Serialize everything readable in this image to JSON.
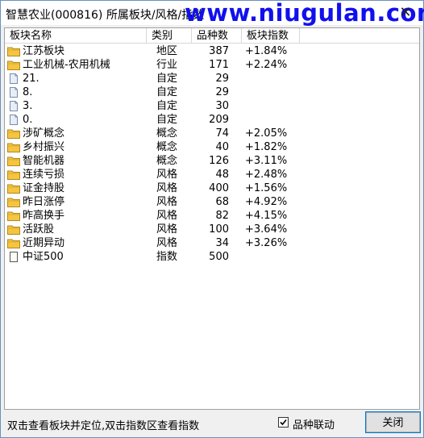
{
  "window": {
    "title": "智慧农业(000816) 所属板块/风格/指数",
    "watermark": "www.niugulan.com",
    "close_glyph": "✕"
  },
  "list": {
    "columns": [
      "板块名称",
      "类别",
      "品种数",
      "板块指数"
    ],
    "rows": [
      {
        "name": "江苏板块",
        "type": "地区",
        "count": "387",
        "index": "+1.84%",
        "icon": "folder-icon"
      },
      {
        "name": "工业机械-农用机械",
        "type": "行业",
        "count": "171",
        "index": "+2.24%",
        "icon": "folder-icon"
      },
      {
        "name": "21.",
        "type": "自定",
        "count": "29",
        "index": "",
        "icon": "document-icon"
      },
      {
        "name": "8.",
        "type": "自定",
        "count": "29",
        "index": "",
        "icon": "document-icon"
      },
      {
        "name": "3.",
        "type": "自定",
        "count": "30",
        "index": "",
        "icon": "document-icon"
      },
      {
        "name": "0.",
        "type": "自定",
        "count": "209",
        "index": "",
        "icon": "document-icon"
      },
      {
        "name": "涉矿概念",
        "type": "概念",
        "count": "74",
        "index": "+2.05%",
        "icon": "folder-icon"
      },
      {
        "name": "乡村振兴",
        "type": "概念",
        "count": "40",
        "index": "+1.82%",
        "icon": "folder-icon"
      },
      {
        "name": "智能机器",
        "type": "概念",
        "count": "126",
        "index": "+3.11%",
        "icon": "folder-icon"
      },
      {
        "name": "连续亏损",
        "type": "风格",
        "count": "48",
        "index": "+2.48%",
        "icon": "folder-icon"
      },
      {
        "name": "证金持股",
        "type": "风格",
        "count": "400",
        "index": "+1.56%",
        "icon": "folder-icon"
      },
      {
        "name": "昨日涨停",
        "type": "风格",
        "count": "68",
        "index": "+4.92%",
        "icon": "folder-icon"
      },
      {
        "name": "昨高换手",
        "type": "风格",
        "count": "82",
        "index": "+4.15%",
        "icon": "folder-icon"
      },
      {
        "name": "活跃股",
        "type": "风格",
        "count": "100",
        "index": "+3.64%",
        "icon": "folder-icon"
      },
      {
        "name": "近期异动",
        "type": "风格",
        "count": "34",
        "index": "+3.26%",
        "icon": "folder-icon"
      },
      {
        "name": "中证500",
        "type": "指数",
        "count": "500",
        "index": "",
        "icon": "page-icon"
      }
    ]
  },
  "status": {
    "hint": "双击查看板块并定位,双击指数区查看指数",
    "checkbox_label": "品种联动",
    "checkbox_checked": true,
    "close_button": "关闭"
  },
  "colors": {
    "folder": "#f5c542",
    "watermark": "#1010ee",
    "accent": "#0078d7"
  }
}
